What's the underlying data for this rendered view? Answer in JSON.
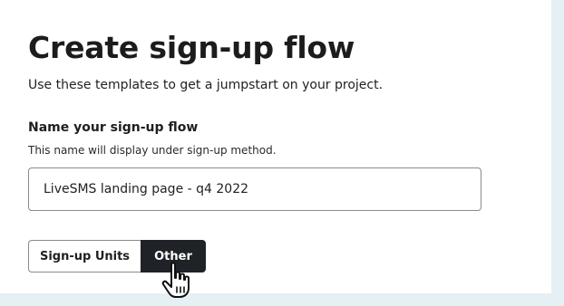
{
  "page": {
    "title": "Create sign-up flow",
    "subtitle": "Use these templates to get a jumpstart on your project."
  },
  "name_field": {
    "label": "Name your sign-up flow",
    "help": "This name will display under sign-up method.",
    "value": "LiveSMS landing page - q4 2022"
  },
  "type_toggle": {
    "options": [
      {
        "label": "Sign-up Units",
        "selected": false
      },
      {
        "label": "Other",
        "selected": true
      }
    ]
  },
  "cursor": {
    "icon": "hand-pointer-icon"
  },
  "colors": {
    "selected_segment": "#1f2226",
    "page_background": "#e4f0f4",
    "panel": "#ffffff"
  }
}
